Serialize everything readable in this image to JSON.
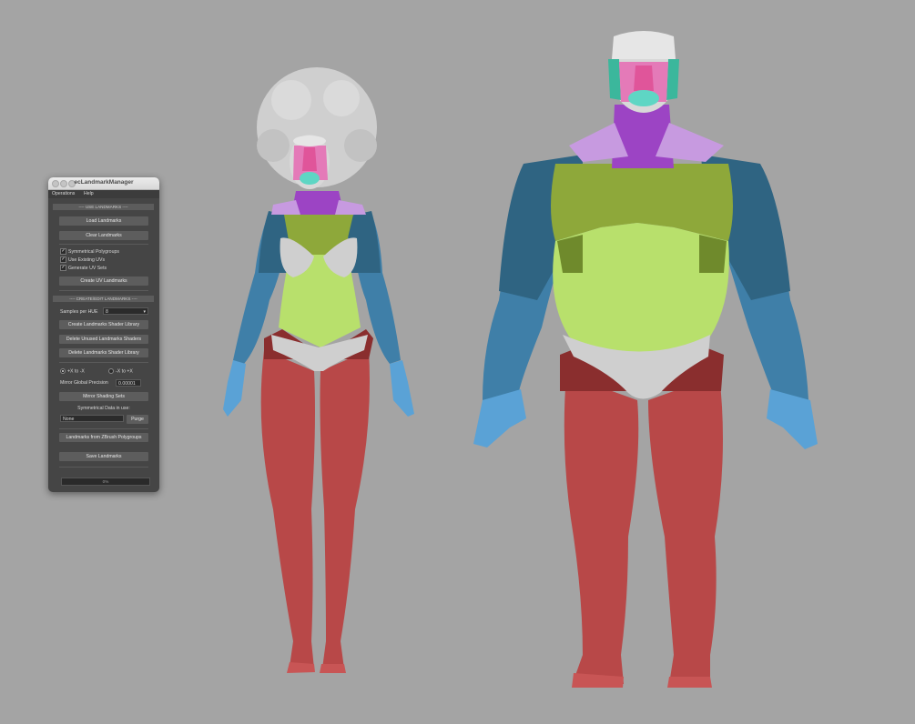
{
  "window": {
    "title": "ecLandmarkManager",
    "menus": [
      "Operations",
      "Help"
    ]
  },
  "use_landmarks": {
    "header": "---- USE LANDMARKS ----",
    "load_label": "Load Landmarks",
    "clear_label": "Clear Landmarks",
    "checkboxes": [
      {
        "label": "Symmetrical Polygroups",
        "checked": true
      },
      {
        "label": "Use Existing UVs",
        "checked": true
      },
      {
        "label": "Generate UV Sets",
        "checked": true
      }
    ],
    "create_uv_label": "Create UV Landmarks"
  },
  "create_edit": {
    "header": "---- CREATE/EDIT LANDMARKS ----",
    "samples_label": "Samples per HUE",
    "samples_value": "8",
    "create_library_label": "Create Landmarks Shader Library",
    "delete_unused_label": "Delete Unused Landmarks Shaders",
    "delete_library_label": "Delete Landmarks Shader Library",
    "radio_pos": "+X to -X",
    "radio_neg": "-X to +X",
    "precision_label": "Mirror Global Precision",
    "precision_value": "0.00001",
    "mirror_sets_label": "Mirror Shading Sets",
    "sym_data_label": "Symmetrical Data in use:",
    "sym_data_value": "None",
    "purge_label": "Purge",
    "zbrush_label": "Landmarks from ZBrush Polygroups",
    "save_label": "Save Landmarks",
    "progress_text": "0%",
    "progress_value": 0
  },
  "colors": {
    "background": "#a4a4a4",
    "skin_base": "#d8d8d8",
    "head_pink": "#e47ab8",
    "nose_magenta": "#e0559a",
    "mouth_teal": "#5ed6c4",
    "neck_purple": "#9c44c4",
    "collar_lilac": "#c79ae0",
    "shoulder_blue": "#2f6482",
    "arm_blue": "#3f7fa8",
    "hand_blue": "#5aa2d6",
    "chest_green": "#8ea83a",
    "belly_green": "#b8e06c",
    "underwear_grey": "#cfcfcf",
    "hip_red": "#8a2e2e",
    "leg_red": "#b84848"
  }
}
